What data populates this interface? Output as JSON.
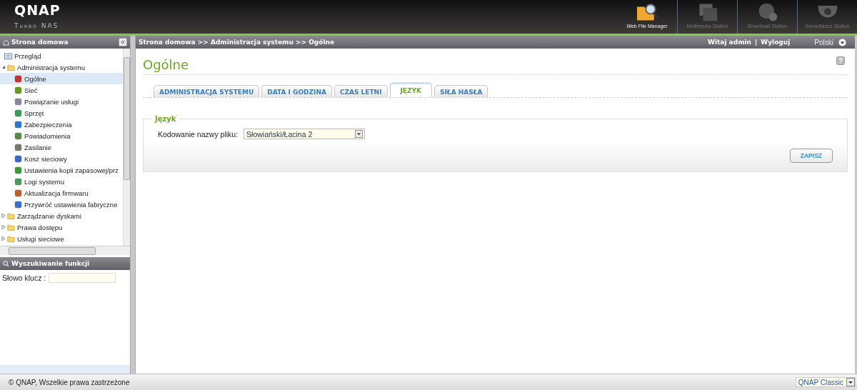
{
  "header": {
    "logo": "QNAP",
    "product": "Turbo NAS",
    "apps": [
      {
        "label": "Web File Manager",
        "kind": "filemanager",
        "disabled": false
      },
      {
        "label": "Multimedia Station",
        "kind": "multimedia",
        "disabled": true
      },
      {
        "label": "Download Station",
        "kind": "download",
        "disabled": true
      },
      {
        "label": "Surveillance Station",
        "kind": "surveillance",
        "disabled": true
      }
    ]
  },
  "sidebar": {
    "title": "Strona domowa",
    "tree": [
      {
        "label": "Przegląd",
        "kind": "overview"
      },
      {
        "label": "Administracja systemu",
        "kind": "folder",
        "expanded": true,
        "children": [
          {
            "label": "Ogólne",
            "kind": "settings",
            "selected": true
          },
          {
            "label": "Sieć",
            "kind": "settings",
            "selected": false
          },
          {
            "label": "Powiązanie usługi",
            "kind": "settings",
            "selected": false
          },
          {
            "label": "Sprzęt",
            "kind": "settings",
            "selected": false
          },
          {
            "label": "Zabezpieczenia",
            "kind": "settings",
            "selected": false
          },
          {
            "label": "Powiadomienia",
            "kind": "settings",
            "selected": false
          },
          {
            "label": "Zasilanie",
            "kind": "settings",
            "selected": false
          },
          {
            "label": "Kosz sieciowy",
            "kind": "settings",
            "selected": false
          },
          {
            "label": "Ustawienia kopii zapasowej/prz",
            "kind": "settings",
            "selected": false
          },
          {
            "label": "Logi systemu",
            "kind": "settings",
            "selected": false
          },
          {
            "label": "Aktualizacja firmwaru",
            "kind": "settings",
            "selected": false
          },
          {
            "label": "Przywróć ustawienia fabryczne",
            "kind": "settings",
            "selected": false
          }
        ]
      },
      {
        "label": "Zarządzanie dyskami",
        "kind": "folder",
        "expanded": false
      },
      {
        "label": "Prawa dostępu",
        "kind": "folder",
        "expanded": false
      },
      {
        "label": "Usługi sieciowe",
        "kind": "folder",
        "expanded": false
      }
    ],
    "search": {
      "title": "Wyszukiwanie funkcji",
      "label": "Słowo klucz :"
    }
  },
  "topbar": {
    "breadcrumb": "Strona domowa >> Administracja systemu >> Ogólne",
    "welcome": "Witaj admin",
    "separator": "|",
    "logout": "Wyloguj",
    "language": "Polski"
  },
  "page": {
    "title": "Ogólne",
    "tabs": [
      {
        "label": "ADMINISTRACJA SYSTEMU",
        "selected": false
      },
      {
        "label": "DATA I GODZINA",
        "selected": false
      },
      {
        "label": "CZAS LETNI",
        "selected": false
      },
      {
        "label": "JĘZYK",
        "selected": true
      },
      {
        "label": "SIŁA HASŁA",
        "selected": false
      }
    ],
    "section": {
      "legend": "Język",
      "field_label": "Kodowanie nazwy pliku:",
      "field_value": "Słowiański/Łacina 2",
      "button": "ZAPISZ"
    }
  },
  "footer": {
    "copyright": "© QNAP, Wszelkie prawa zastrzeżone",
    "theme": "QNAP Classic"
  }
}
